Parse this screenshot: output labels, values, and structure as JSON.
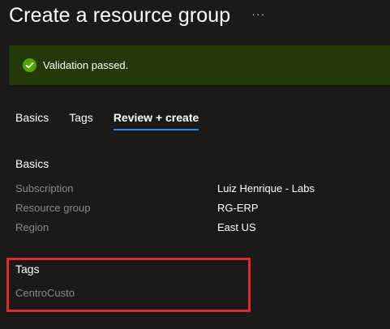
{
  "header": {
    "title": "Create a resource group",
    "more_label": "···"
  },
  "banner": {
    "message": "Validation passed.",
    "status_color": "#57a300",
    "background": "#233a08",
    "icon": "check-circle-icon"
  },
  "tabs": [
    {
      "label": "Basics",
      "active": false
    },
    {
      "label": "Tags",
      "active": false
    },
    {
      "label": "Review + create",
      "active": true
    }
  ],
  "basics": {
    "heading": "Basics",
    "rows": [
      {
        "label": "Subscription",
        "value": "Luiz Henrique - Labs"
      },
      {
        "label": "Resource group",
        "value": "RG-ERP"
      },
      {
        "label": "Region",
        "value": "East US"
      }
    ]
  },
  "tags": {
    "heading": "Tags",
    "items": [
      {
        "name": "CentroCusto"
      }
    ],
    "highlight_color": "#e02a2a"
  },
  "colors": {
    "accent": "#2b88d8",
    "background": "#1b1a19",
    "label_gray": "#8a8886"
  }
}
